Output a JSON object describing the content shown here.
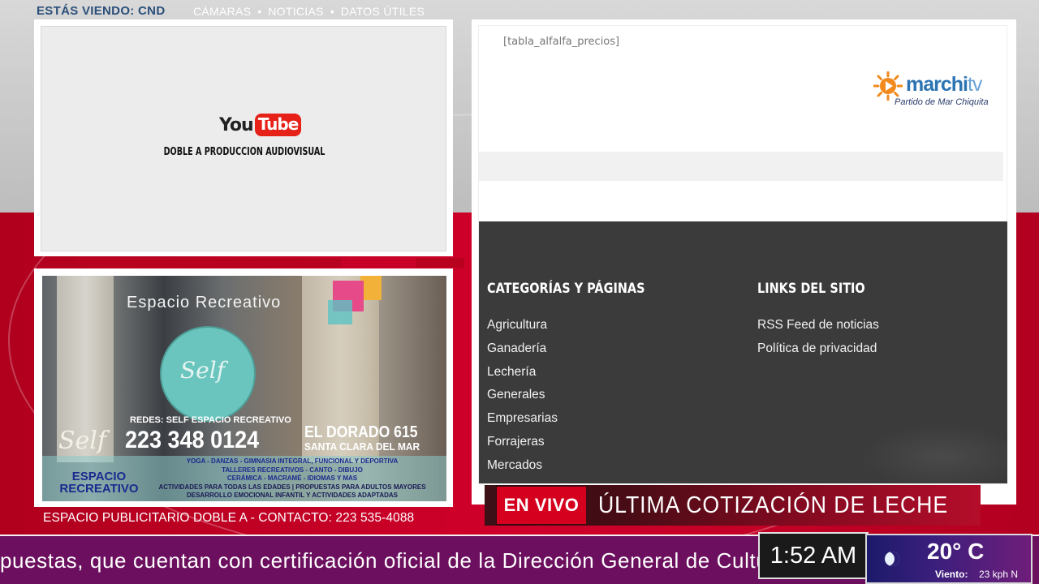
{
  "top_bar": {
    "watching": "ESTÁS VIENDO: CND",
    "menu": [
      "CÁMARAS",
      "NOTICIAS",
      "DATOS ÚTILES"
    ],
    "separator": "•"
  },
  "video": {
    "yt_you": "You",
    "yt_tube": "Tube",
    "caption": "DOBLE A PRODUCCION AUDIOVISUAL"
  },
  "ad": {
    "title": "Espacio Recreativo",
    "circle_text": "Self",
    "redes": "REDES: SELF ESPACIO RECREATIVO",
    "phone": "223 348 0124",
    "address": "EL DORADO 615",
    "city": "SANTA CLARA DEL MAR",
    "lines_blue": [
      "YOGA - DANZAS - GIMNASIA INTEGRAL, FUNCIONAL Y DEPORTIVA",
      "TALLERES RECREATIVOS - CANTO - DIBUJO",
      "CERÁMICA - MACRAMÉ - IDIOMAS Y MAS"
    ],
    "lines_dark": [
      "ACTIVIDADES PARA TODAS LAS EDADES | PROPUESTAS PARA ADULTOS MAYORES",
      "DESARROLLO EMOCIONAL INFANTIL Y ACTIVIDADES ADAPTADAS"
    ],
    "brand_small": "Self",
    "brand_line1": "ESPACIO",
    "brand_line2": "RECREATIVO",
    "footer": "ESPACIO PUBLICITARIO DOBLE A - CONTACTO: 223 535-4088"
  },
  "web": {
    "shortcode": "[tabla_alfalfa_precios]",
    "logo": {
      "brand": "marchi",
      "brand_suffix": "tv",
      "subtitle": "Partido de Mar Chiquita"
    },
    "footer": {
      "categories_title": "CATEGORÍAS Y PÁGINAS",
      "categories": [
        "Agricultura",
        "Ganadería",
        "Lechería",
        "Generales",
        "Empresarias",
        "Forrajeras",
        "Mercados"
      ],
      "links_title": "LINKS DEL SITIO",
      "links": [
        "RSS Feed de noticias",
        "Política de privacidad"
      ]
    }
  },
  "live": {
    "badge": "EN VIVO",
    "headline": "ÚLTIMA COTIZACIÓN DE LECHE"
  },
  "ticker": {
    "text": "puestas, que cuentan con certificación oficial de la Dirección General de Cultura"
  },
  "clock": {
    "time": "1:52 AM"
  },
  "weather": {
    "icon": "moon-icon",
    "temp": "20° C",
    "wind_label": "Viento:",
    "wind_value": "23 kph N"
  },
  "colors": {
    "live_red": "#d4001e",
    "ticker_purple": "#6b0f5e",
    "brand_blue": "#2c74b3",
    "sun_orange": "#f28a1e"
  }
}
